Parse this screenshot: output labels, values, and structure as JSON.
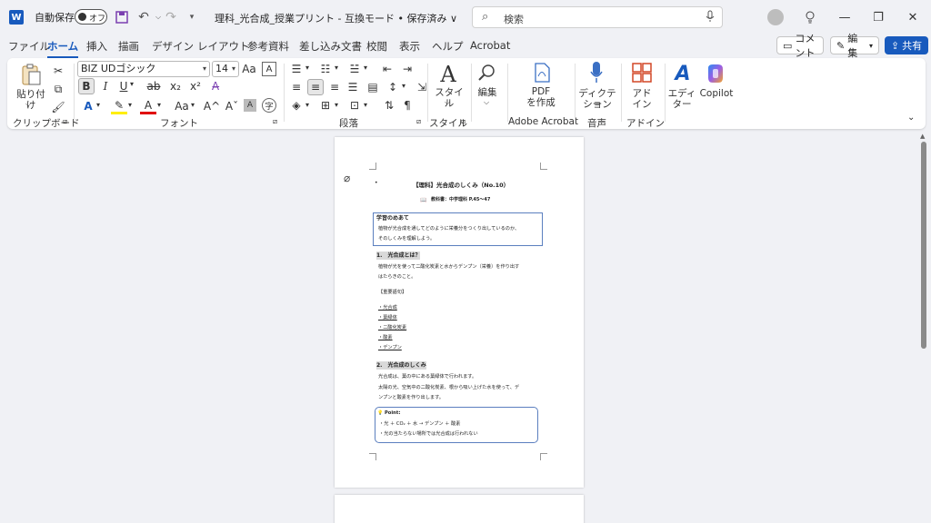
{
  "titlebar": {
    "logo": "W",
    "autosave_label": "自動保存",
    "toggle_label": "オフ",
    "doc_title": "理科_光合成_授業プリント  -  互換モード • 保存済み ∨",
    "search_placeholder": "検索",
    "icons": [
      "save-icon",
      "undo-icon",
      "redo-icon",
      "customize-icon",
      "mic-icon",
      "lightbulb-icon",
      "minimize-icon",
      "restore-icon",
      "close-icon"
    ]
  },
  "tabs": [
    "ファイル",
    "ホーム",
    "挿入",
    "描画",
    "デザイン",
    "レイアウト",
    "参考資料",
    "差し込み文書",
    "校閲",
    "表示",
    "ヘルプ",
    "Acrobat"
  ],
  "tab_buttons": {
    "comment": "コメント",
    "edit": "編集",
    "share": "共有"
  },
  "ribbon": {
    "clipboard": {
      "paste": "貼り付け",
      "label": "クリップボード"
    },
    "font": {
      "name": "BIZ UDゴシック",
      "size": "14",
      "label": "フォント",
      "bold": "B",
      "italic": "I",
      "underline": "U",
      "strike": "ab",
      "sub": "x₂",
      "sup": "x²",
      "change_case": "Aa",
      "grow": "A^",
      "shrink": "Aˇ"
    },
    "paragraph": {
      "label": "段落"
    },
    "styles": {
      "button": "スタイル",
      "label": "スタイル"
    },
    "editing": {
      "button": "編集"
    },
    "acrobat": {
      "button": "PDF\nを作成",
      "line1": "PDF",
      "line2": "を作成",
      "label": "Adobe Acrobat"
    },
    "voice": {
      "line1": "ディクテー",
      "line2": "ション",
      "label": "音声"
    },
    "addins": {
      "line1": "アド",
      "line2": "イン",
      "label": "アドイン"
    },
    "editor": {
      "line1": "エディ",
      "line2": "ター"
    },
    "copilot": {
      "button": "Copilot"
    }
  },
  "document": {
    "title": "【理科】光合成のしくみ（No.10）",
    "textbook": "教科書：中学理科 P.45〜47",
    "goal_heading": "学習のめあて",
    "goal_line1": "植物が光合成を通してどのように栄養分をつくり出しているのか、",
    "goal_line2": "そのしくみを理解しよう。",
    "sec1_heading": "1.　光合成とは？",
    "sec1_line1": "植物が光を使って二酸化炭素と水からデンプン（栄養）を作り出す",
    "sec1_line2": "はたらきのこと。",
    "keywords_heading": "【重要語句】",
    "keywords": [
      "・光合成",
      "・葉緑体",
      "・二酸化炭素",
      "・酸素",
      "・デンプン"
    ],
    "sec2_heading": "2.　光合成のしくみ",
    "sec2_line1": "光合成は、葉の中にある葉緑体で行われます。",
    "sec2_line2": "太陽の光、空気中の二酸化炭素、根から吸い上げた水を使って、デ",
    "sec2_line3": "ンプンと酸素を作り出します。",
    "point_heading": "Point:",
    "point_line1": "・光 ＋ CO₂ ＋ 水 → デンプン ＋ 酸素",
    "point_line2": "・光の当たらない場所では光合成は行われない"
  }
}
